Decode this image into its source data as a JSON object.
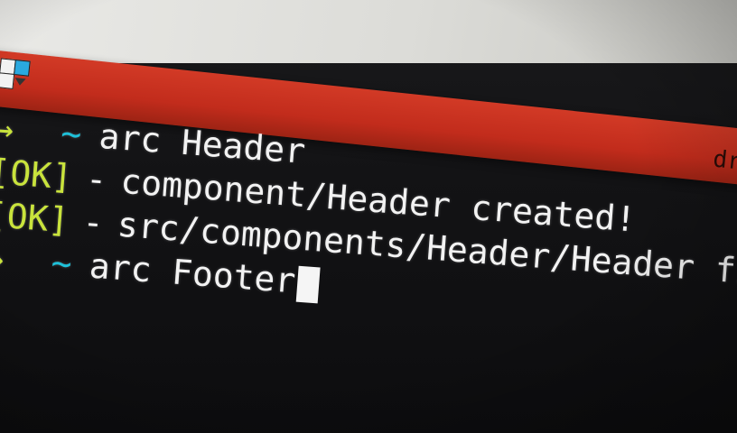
{
  "window": {
    "title": "dr",
    "app_icon": "terminal-app-icon"
  },
  "terminal": {
    "prompt_arrow": "→",
    "prompt_dir": "~",
    "lines": [
      {
        "kind": "prompt",
        "command": "arc Header"
      },
      {
        "kind": "output",
        "status": "[OK]",
        "sep": "-",
        "text": "component/Header created!"
      },
      {
        "kind": "output",
        "status": "[OK]",
        "sep": "-",
        "text": "src/components/Header/Header fi"
      },
      {
        "kind": "prompt",
        "command": "arc Footer"
      }
    ]
  },
  "colors": {
    "titlebar": "#c7301f",
    "background": "#131315",
    "arrow_and_ok": "#c9e33c",
    "tilde": "#1fc0d8",
    "text": "#f2f2f2"
  }
}
